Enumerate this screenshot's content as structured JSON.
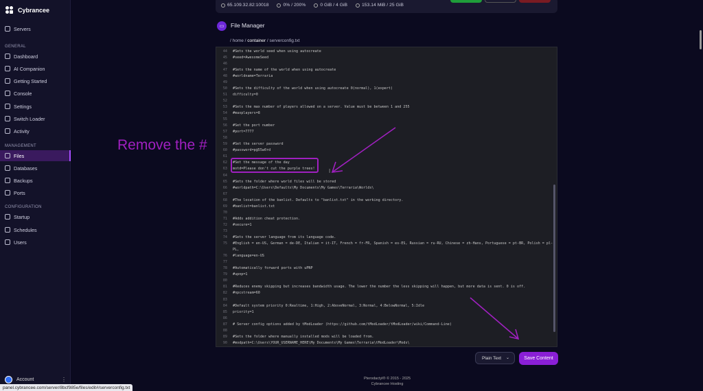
{
  "app": {
    "brand": "Cybrancee"
  },
  "sidebar": {
    "servers": "Servers",
    "general_label": "GENERAL",
    "general": [
      "Dashboard",
      "AI Companion",
      "Getting Started",
      "Console",
      "Settings",
      "Switch Loader",
      "Activity"
    ],
    "management_label": "MANAGEMENT",
    "management": [
      "Files",
      "Databases",
      "Backups",
      "Ports"
    ],
    "configuration_label": "CONFIGURATION",
    "configuration": [
      "Startup",
      "Schedules",
      "Users"
    ],
    "account": "Account"
  },
  "stats": {
    "ip": "65.109.32.82:10018",
    "cpu": "0% / 200%",
    "disk": "0 GiB / 4 GiB",
    "memory": "153.14 MiB / 25 GiB"
  },
  "file_manager": {
    "title": "File Manager",
    "path_prefix": "/ home / ",
    "path_dir": "container",
    "path_file": " / serverconfig.txt"
  },
  "editor_lines": [
    {
      "n": "44",
      "t": "#Sets the world seed when using autocreate"
    },
    {
      "n": "45",
      "t": "#seed=AwesomeSeed"
    },
    {
      "n": "46",
      "t": ""
    },
    {
      "n": "47",
      "t": "#Sets the name of the world when using autocreate"
    },
    {
      "n": "48",
      "t": "#worldname=Terraria"
    },
    {
      "n": "49",
      "t": ""
    },
    {
      "n": "50",
      "t": "#Sets the difficulty of the world when using autocreate 0(normal), 1(expert)"
    },
    {
      "n": "51",
      "t": "difficulty=0"
    },
    {
      "n": "52",
      "t": ""
    },
    {
      "n": "53",
      "t": "#Sets the max number of players allowed on a server.  Value must be between 1 and 255"
    },
    {
      "n": "54",
      "t": "#maxplayers=8"
    },
    {
      "n": "55",
      "t": ""
    },
    {
      "n": "56",
      "t": "#Set the port number"
    },
    {
      "n": "57",
      "t": "#port=7777"
    },
    {
      "n": "58",
      "t": ""
    },
    {
      "n": "59",
      "t": "#Set the server password"
    },
    {
      "n": "60",
      "t": "#password=p@55w0rd"
    },
    {
      "n": "61",
      "t": ""
    },
    {
      "n": "62",
      "t": "#Set the message of the day"
    },
    {
      "n": "63",
      "t": "motd=Please don't cut the purple trees!"
    },
    {
      "n": "64",
      "t": ""
    },
    {
      "n": "65",
      "t": "#Sets the folder where world files will be stored"
    },
    {
      "n": "66",
      "t": "#worldpath=C:\\Users\\Defaults\\My Documents\\My Games\\Terraria\\Worlds\\"
    },
    {
      "n": "67",
      "t": ""
    },
    {
      "n": "68",
      "t": "#The location of the banlist. Defaults to \"banlist.txt\" in the working directory."
    },
    {
      "n": "69",
      "t": "#banlist=banlist.txt"
    },
    {
      "n": "70",
      "t": ""
    },
    {
      "n": "71",
      "t": "#Adds addition cheat protection."
    },
    {
      "n": "72",
      "t": "#secure=1"
    },
    {
      "n": "73",
      "t": ""
    },
    {
      "n": "74",
      "t": "#Sets the server language from its language code."
    },
    {
      "n": "75",
      "t": "#English = en-US, German = de-DE, Italian = it-IT, French = fr-FR, Spanish = es-ES, Russian = ru-RU, Chinese = zh-Hans, Portuguese = pt-BR, Polish = pl-"
    },
    {
      "n": "",
      "t": "PL,"
    },
    {
      "n": "76",
      "t": "#language=en-US"
    },
    {
      "n": "77",
      "t": ""
    },
    {
      "n": "78",
      "t": "#Automatically forward ports with uPNP"
    },
    {
      "n": "79",
      "t": "#upnp=1"
    },
    {
      "n": "80",
      "t": ""
    },
    {
      "n": "81",
      "t": "#Reduces enemy skipping but increases bandwidth usage. The lower the number the less skipping will happen, but more data is sent. 0 is off."
    },
    {
      "n": "82",
      "t": "#npcstream=60"
    },
    {
      "n": "83",
      "t": ""
    },
    {
      "n": "84",
      "t": "#Default system priority 0:Realtime, 1:High, 2:AboveNormal, 3:Normal, 4:BelowNormal, 5:Idle"
    },
    {
      "n": "85",
      "t": "priority=1"
    },
    {
      "n": "86",
      "t": ""
    },
    {
      "n": "87",
      "t": "# Server config options added by tModLoader (https://github.com/tModLoader/tModLoader/wiki/Command-Line)"
    },
    {
      "n": "88",
      "t": ""
    },
    {
      "n": "89",
      "t": "#Sets the folder where manually installed mods will be loaded from."
    },
    {
      "n": "90",
      "t": "#modpath=C:\\Users\\YOUR_USERNAME_HERE\\My Documents\\My Games\\Terraria\\tModLoader\\Mods\\"
    }
  ],
  "controls": {
    "mode": "Plain Text",
    "save": "Save Content"
  },
  "footer": {
    "copyright": "Pterodactyl® © 2015 - 2025",
    "host": "Cybrancee Hosting"
  },
  "annotation": {
    "text": "Remove the #"
  },
  "statusbar": {
    "url": "panel.cybrancee.com/server/8bcf985e/files/edit#/serverconfig.txt"
  },
  "colors": {
    "accent": "#8a1fd6",
    "annotation": "#a020c0",
    "background": "#0b0a1f",
    "sidebar": "#131229",
    "editor": "#1d1e24"
  }
}
